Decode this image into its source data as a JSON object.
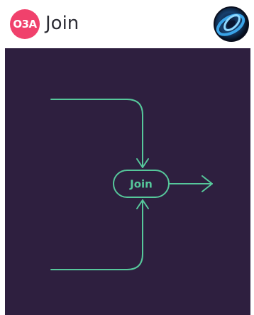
{
  "header": {
    "badge": "O3A",
    "title": "Join",
    "logo_icon": "swirl-logo-icon"
  },
  "diagram": {
    "node_label": "Join",
    "line_color": "#56c79b",
    "background": "#2e1f3f",
    "badge_color": "#f0416c"
  }
}
